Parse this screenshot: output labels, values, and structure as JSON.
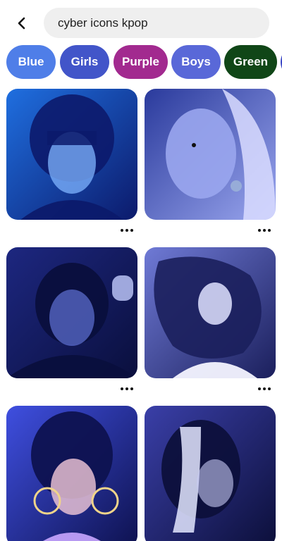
{
  "search": {
    "query": "cyber icons kpop"
  },
  "icons": {
    "back": "back-arrow-icon",
    "more": "more-options-icon"
  },
  "chips": [
    {
      "label": "Blue",
      "color": "#4f7ee8"
    },
    {
      "label": "Girls",
      "color": "#4255c9"
    },
    {
      "label": "Purple",
      "color": "#a22a8f"
    },
    {
      "label": "Boys",
      "color": "#5968d8"
    },
    {
      "label": "Green",
      "color": "#104617"
    },
    {
      "label": "",
      "color": "#3b47c6"
    }
  ],
  "pins": [
    {
      "palette": [
        "#1f6fe0",
        "#0c1a6b",
        "#7fb4ff"
      ]
    },
    {
      "palette": [
        "#2a3a9c",
        "#9aa6ee",
        "#d9dcff"
      ]
    },
    {
      "palette": [
        "#1d2780",
        "#0a0f3d",
        "#5f72d6"
      ]
    },
    {
      "palette": [
        "#6f7ad6",
        "#1b1f5c",
        "#dfe2ff"
      ]
    },
    {
      "palette": [
        "#3f4fe0",
        "#0e1250",
        "#c9a6ff"
      ]
    },
    {
      "palette": [
        "#3a3fa8",
        "#0c0f3a",
        "#e3e6ff"
      ]
    }
  ]
}
